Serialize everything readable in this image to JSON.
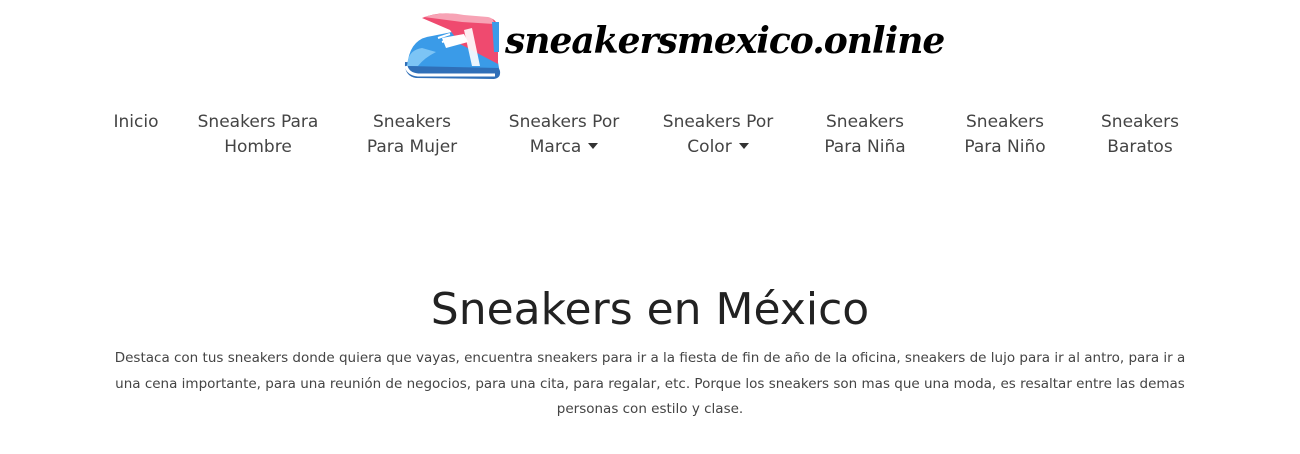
{
  "brand": {
    "logo_text": "sneakersmexico.online",
    "logo_icon": "sneaker-icon",
    "colors": {
      "shoe_blue": "#3a9be8",
      "shoe_pink": "#ef4a6f",
      "shoe_white": "#ffffff"
    }
  },
  "nav": {
    "items": [
      {
        "line1": "Inicio",
        "line2": ""
      },
      {
        "line1": "Sneakers Para",
        "line2": "Hombre"
      },
      {
        "line1": "Sneakers",
        "line2": "Para Mujer"
      },
      {
        "line1": "Sneakers Por",
        "line2": "Marca",
        "dropdown": true
      },
      {
        "line1": "Sneakers Por",
        "line2": "Color",
        "dropdown": true
      },
      {
        "line1": "Sneakers",
        "line2": "Para Niña"
      },
      {
        "line1": "Sneakers",
        "line2": "Para Niño"
      },
      {
        "line1": "Sneakers",
        "line2": "Baratos"
      }
    ]
  },
  "main": {
    "title": "Sneakers en México",
    "description": "Destaca con tus sneakers donde quiera que vayas, encuentra sneakers para ir a la fiesta de fin de año de la oficina, sneakers de lujo para ir al antro, para ir a una cena importante, para una reunión de negocios, para una cita, para regalar, etc. Porque los sneakers son mas que una moda, es resaltar entre las demas personas con estilo y clase."
  }
}
